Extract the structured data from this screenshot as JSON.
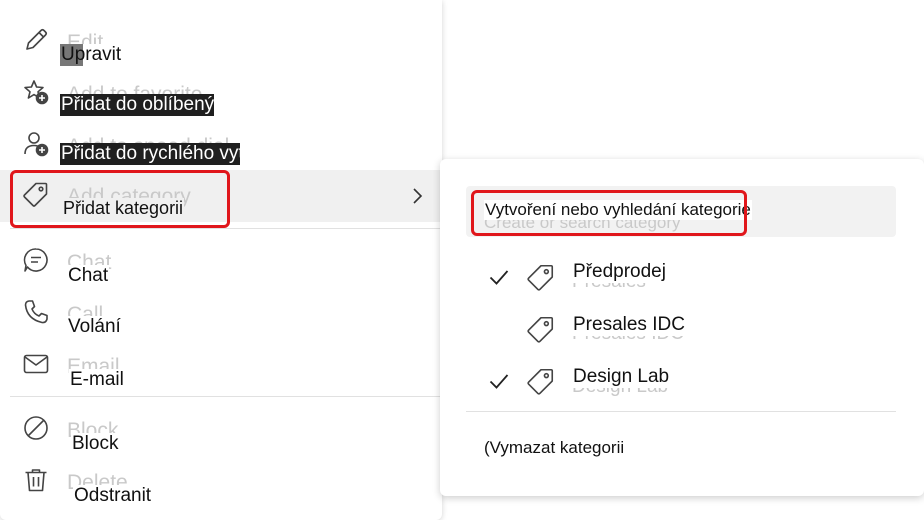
{
  "left_menu": {
    "items": [
      {
        "ghost": "Edit",
        "label": "Upravit",
        "icon": "pencil-icon"
      },
      {
        "ghost": "Add to favorite",
        "label": "Přidat do oblíbených",
        "icon": "star-add-icon"
      },
      {
        "ghost": "Add to speed dial",
        "label": "Přidat do rychlého vytáčení",
        "icon": "person-add-icon"
      },
      {
        "ghost": "Add category",
        "label": "Přidat kategorii",
        "icon": "tag-icon"
      },
      {
        "ghost": "Chat",
        "label": "Chat",
        "icon": "chat-icon"
      },
      {
        "ghost": "Call",
        "label": "Volání",
        "icon": "phone-icon"
      },
      {
        "ghost": "Email",
        "label": "E-mail",
        "icon": "mail-icon"
      },
      {
        "ghost": "Block",
        "label": "Block",
        "icon": "block-icon"
      },
      {
        "ghost": "Delete",
        "label": "Odstranit",
        "icon": "trash-icon"
      }
    ],
    "submenu_chevron_icon": "chevron-right-icon"
  },
  "category_submenu": {
    "search": {
      "ghost": "Create or search category",
      "label": "Vytvoření nebo vyhledání kategorie"
    },
    "categories": [
      {
        "ghost": "Presales",
        "label": "Předprodej",
        "checked": true
      },
      {
        "ghost": "Presales IDC",
        "label": "Presales IDC",
        "checked": false
      },
      {
        "ghost": "Design Lab",
        "label": "Design Lab",
        "checked": true
      }
    ],
    "clear_label": "(Vymazat kategorii"
  },
  "colors": {
    "highlight_outline": "#e0161b",
    "hover_background": "#f0f0f0",
    "ghost_text": "#c9c9c9"
  }
}
